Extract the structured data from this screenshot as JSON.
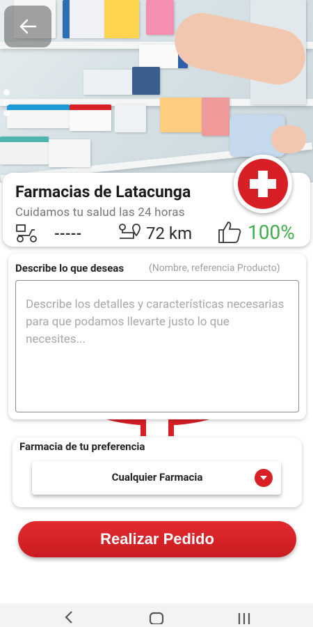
{
  "header": {
    "back_icon": "arrow-left-icon",
    "carousel_pages": 3
  },
  "store": {
    "name": "Farmacias de Latacunga",
    "slogan": "Cuidamos tu salud las 24 horas",
    "delivery_value": "-----",
    "distance": "72 km",
    "rating": "100%",
    "badge_icon": "medical-cross-icon"
  },
  "request": {
    "label": "Describe lo que deseas",
    "hint": "(Nombre, referencia Producto)",
    "placeholder": "Describe los detalles y características necesarias para que podamos llevarte justo lo que necesites..."
  },
  "preference": {
    "label": "Farmacia de tu preferencia",
    "selected": "Cualquier Farmacia"
  },
  "actions": {
    "order_label": "Realizar Pedido"
  },
  "colors": {
    "accent_red": "#d81f26",
    "rating_green": "#3fae49"
  },
  "nav": {
    "back": "nav-back-icon",
    "home": "nav-home-icon",
    "recents": "nav-recents-icon"
  }
}
